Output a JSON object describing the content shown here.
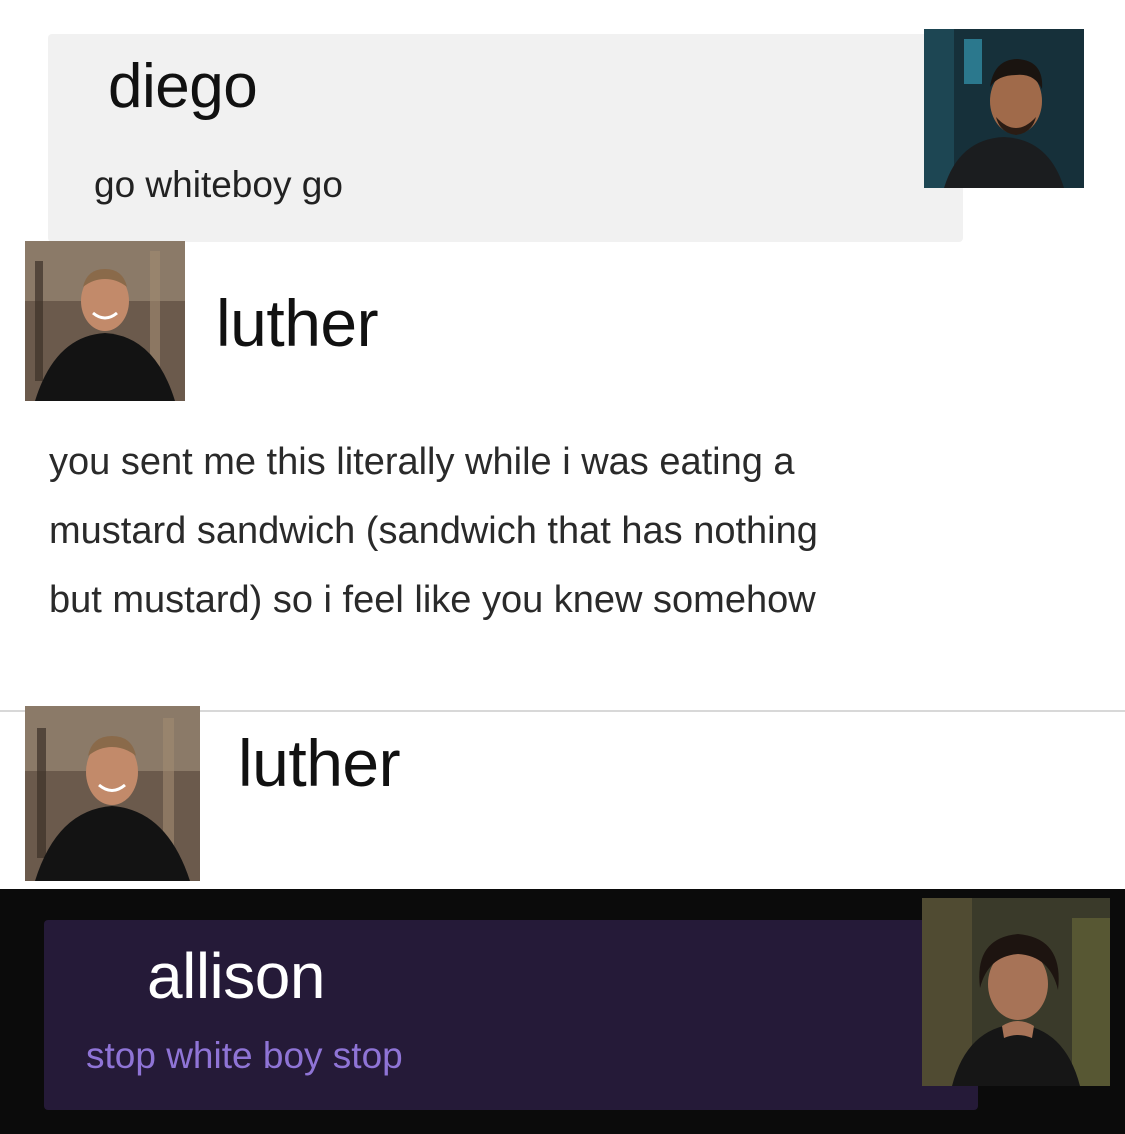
{
  "posts": [
    {
      "author": "diego",
      "message": "go whiteboy go",
      "avatar": "diego-avatar"
    },
    {
      "author": "luther",
      "message_lines": [
        "you sent me this literally while i was eating a",
        "mustard sandwich (sandwich that has nothing",
        "but mustard) so i feel like you knew somehow"
      ],
      "avatar": "luther-avatar"
    },
    {
      "author": "luther",
      "avatar": "luther-avatar"
    },
    {
      "author": "allison",
      "message": "stop white boy stop",
      "avatar": "allison-avatar"
    }
  ],
  "colors": {
    "light_bubble": "#f1f1f1",
    "dark_bubble": "#251a38",
    "allison_text": "#8f74d6",
    "dark_band": "#0b0b0b"
  }
}
